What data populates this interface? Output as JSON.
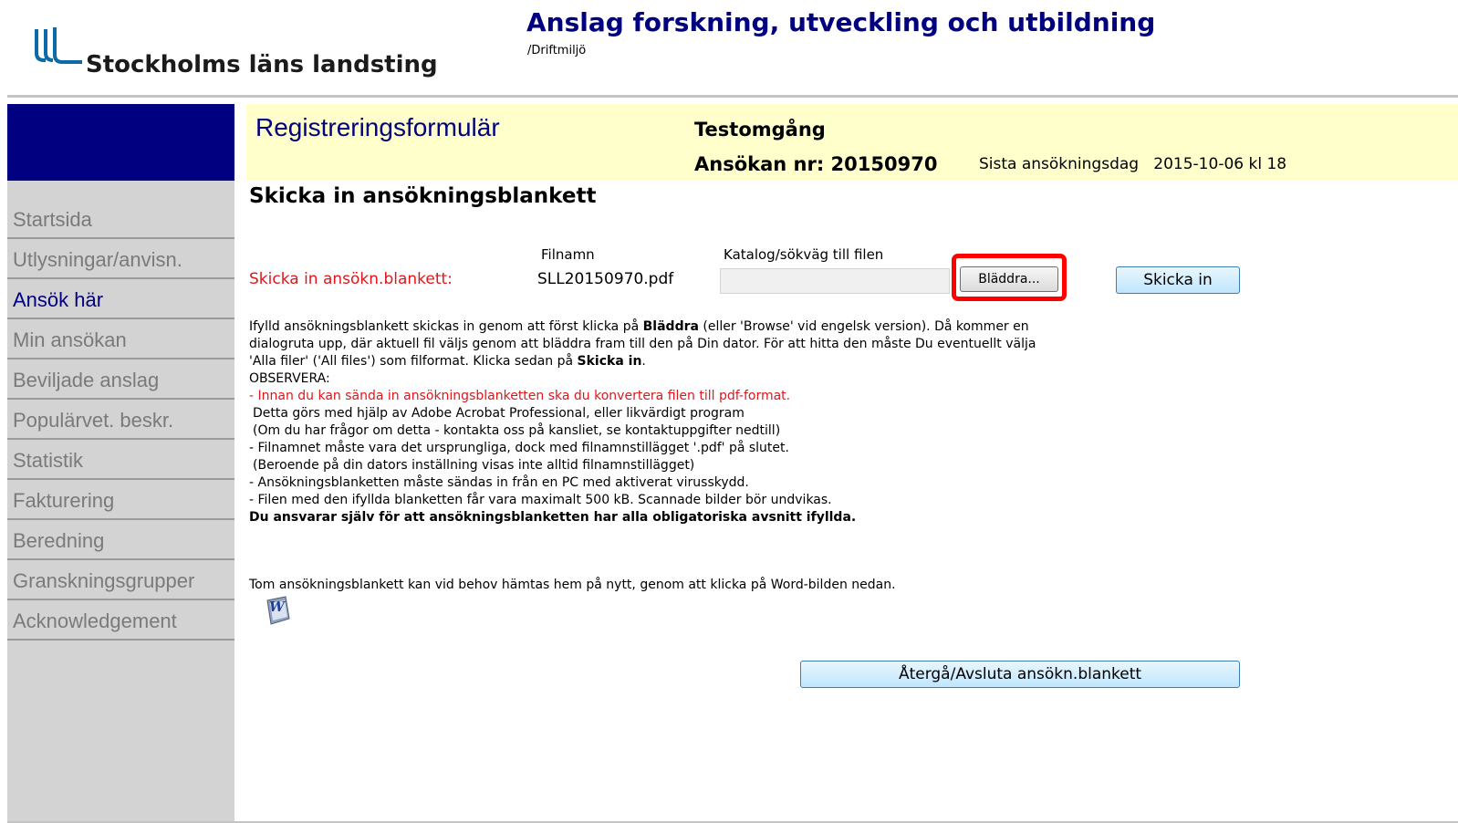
{
  "header": {
    "logo_text": "Stockholms läns landsting",
    "app_title": "Anslag forskning, utveckling och utbildning",
    "environment": "/Driftmiljö"
  },
  "sidebar": {
    "items": [
      {
        "label": "Startsida",
        "active": false
      },
      {
        "label": "Utlysningar/anvisn.",
        "active": false
      },
      {
        "label": "Ansök här",
        "active": true
      },
      {
        "label": "Min ansökan",
        "active": false
      },
      {
        "label": "Beviljade anslag",
        "active": false
      },
      {
        "label": "Populärvet. beskr.",
        "active": false
      },
      {
        "label": "Statistik",
        "active": false
      },
      {
        "label": "Fakturering",
        "active": false
      },
      {
        "label": "Beredning",
        "active": false
      },
      {
        "label": "Granskningsgrupper",
        "active": false
      },
      {
        "label": "Acknowledgement",
        "active": false
      }
    ]
  },
  "band": {
    "form_title": "Registreringsformulär",
    "round_name": "Testomgång",
    "application_number": "Ansökan nr: 20150970",
    "deadline": "Sista ansökningsdag   2015-10-06 kl 18"
  },
  "main": {
    "section_title": "Skicka in ansökningsblankett",
    "filename_header": "Filnamn",
    "path_header": "Katalog/sökväg till filen",
    "upload_label": "Skicka in ansökn.blankett:",
    "file_name": "SLL20150970.pdf",
    "path_value": "",
    "browse_label": "Bläddra...",
    "submit_label": "Skicka in",
    "info": {
      "l1a": "Ifylld ansökningsblankett skickas in genom att först klicka på ",
      "l1b": "Bläddra",
      "l1c": " (eller 'Browse' vid engelsk version). Då kommer en",
      "l2": "dialogruta upp, där aktuell fil väljs genom att bläddra fram till den på Din dator. För att hitta den måste Du eventuellt välja",
      "l3a": "'Alla filer' ('All files') som filformat. Klicka sedan på ",
      "l3b": "Skicka in",
      "l3c": ".",
      "l4": "OBSERVERA:",
      "l5": "- Innan du kan sända in ansökningsblanketten ska du konvertera filen till pdf-format.",
      "l6": "  Detta görs med hjälp av Adobe Acrobat Professional, eller likvärdigt program",
      "l7": "  (Om du har frågor om detta - kontakta oss på kansliet, se kontaktuppgifter nedtill)",
      "l8": "- Filnamnet måste vara det ursprungliga, dock med filnamnstillägget '.pdf' på slutet.",
      "l9": "  (Beroende på din dators inställning visas inte alltid filnamnstillägget)",
      "l10": "- Ansökningsblanketten måste sändas in från en PC med aktiverat virusskydd.",
      "l11": "- Filen med den ifyllda blanketten får vara maximalt 500 kB. Scannade bilder bör undvikas.",
      "l12": "Du ansvarar själv för att ansökningsblanketten har alla obligatoriska avsnitt ifyllda."
    },
    "word_note": "Tom ansökningsblankett kan vid behov hämtas hem på nytt, genom att klicka på Word-bilden nedan.",
    "word_icon": "word-document-icon",
    "return_label": "Återgå/Avsluta ansökn.blankett"
  },
  "colors": {
    "navy": "#000080",
    "band": "#ffffcc",
    "sidebar": "#d3d3d3",
    "warning_red": "#e0161c",
    "highlight": "#ff0000"
  }
}
